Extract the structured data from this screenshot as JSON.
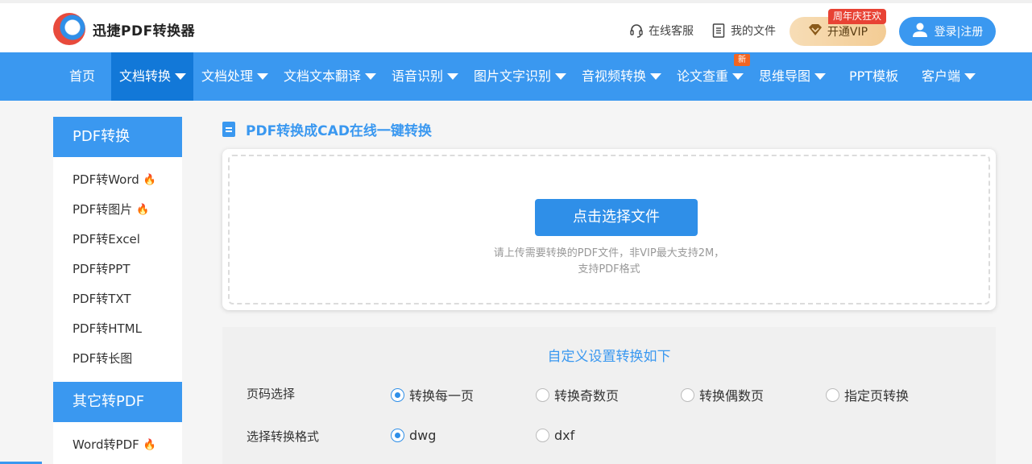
{
  "brand": {
    "name": "迅捷PDF转换器"
  },
  "header": {
    "service": "在线客服",
    "my_files": "我的文件",
    "vip": "开通VIP",
    "vip_badge": "周年庆狂欢",
    "login": "登录|注册"
  },
  "nav": {
    "items": [
      "首页",
      "文档转换",
      "文档处理",
      "文档文本翻译",
      "语音识别",
      "图片文字识别",
      "音视频转换",
      "论文查重",
      "思维导图",
      "PPT模板",
      "客户端"
    ],
    "new_badge": "新"
  },
  "sidebar": {
    "group1_title": "PDF转换",
    "group1_items": [
      "PDF转Word",
      "PDF转图片",
      "PDF转Excel",
      "PDF转PPT",
      "PDF转TXT",
      "PDF转HTML",
      "PDF转长图"
    ],
    "group2_title": "其它转PDF",
    "group2_items": [
      "Word转PDF"
    ]
  },
  "main": {
    "title": "PDF转换成CAD在线一键转换",
    "select_button": "点击选择文件",
    "hint_line1": "请上传需要转换的PDF文件，非VIP最大支持2M，",
    "hint_line2": "支持PDF格式"
  },
  "settings": {
    "title": "自定义设置转换如下",
    "page_label": "页码选择",
    "page_options": [
      "转换每一页",
      "转换奇数页",
      "转换偶数页",
      "指定页转换"
    ],
    "page_selected": "转换每一页",
    "format_label": "选择转换格式",
    "format_options": [
      "dwg",
      "dxf"
    ],
    "format_selected": "dwg"
  },
  "colors": {
    "primary": "#3a98f0",
    "nav_active": "#1278d8",
    "hot": "#f26522",
    "badge_red": "#e84234"
  }
}
